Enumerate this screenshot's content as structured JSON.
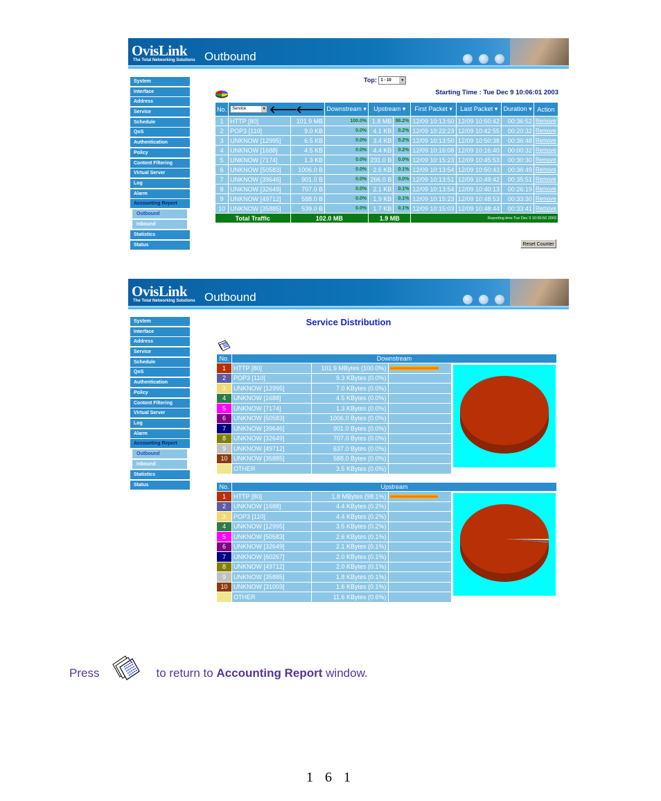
{
  "brand": {
    "logo": "OvisLink",
    "tagline": "The Total Networking Solutions"
  },
  "sidebar": {
    "items": [
      "System",
      "Interface",
      "Address",
      "Service",
      "Schedule",
      "QoS",
      "Authentication",
      "Policy",
      "Content Filtering",
      "Virtual Server",
      "Log",
      "Alarm",
      "Accounting Report"
    ],
    "subitems": [
      "Outbound",
      "Inbound"
    ],
    "after": [
      "Statistics",
      "Status"
    ]
  },
  "screen1": {
    "title": "Outbound",
    "top_label": "Top:",
    "top_value": "1 - 10",
    "starting_time": "Starting Time : Tue Dec 9 10:06:01 2003",
    "service_select": "Service",
    "columns": [
      "No.",
      "Downstream",
      "Upstream",
      "First Packet",
      "Last Packet",
      "Duration",
      "Action"
    ],
    "rows": [
      {
        "no": "1",
        "name": "HTTP [80]",
        "down": "101.9 MB",
        "down_pct": "100.0%",
        "up": "1.8 MB",
        "up_pct": "98.2%",
        "first": "12/09 10:13:50",
        "last": "12/09 10:50:42",
        "dur": "00:36:52",
        "action": "Remove"
      },
      {
        "no": "2",
        "name": "POP3 [110]",
        "down": "9.0 KB",
        "down_pct": "0.0%",
        "up": "4.1 KB",
        "up_pct": "0.2%",
        "first": "12/09 10:22:23",
        "last": "12/09 10:42:55",
        "dur": "00:20:32",
        "action": "Remove"
      },
      {
        "no": "3",
        "name": "UNKNOW [12995]",
        "down": "6.5 KB",
        "down_pct": "0.0%",
        "up": "3.4 KB",
        "up_pct": "0.2%",
        "first": "12/09 10:13:50",
        "last": "12/09 10:50:38",
        "dur": "00:36:48",
        "action": "Remove"
      },
      {
        "no": "4",
        "name": "UNKNOW [1688]",
        "down": "4.5 KB",
        "down_pct": "0.0%",
        "up": "4.4 KB",
        "up_pct": "0.2%",
        "first": "12/09 10:16:08",
        "last": "12/09 10:16:40",
        "dur": "00:00:32",
        "action": "Remove"
      },
      {
        "no": "5",
        "name": "UNKNOW [7174]",
        "down": "1.3 KB",
        "down_pct": "0.0%",
        "up": "231.0 B",
        "up_pct": "0.0%",
        "first": "12/09 10:15:23",
        "last": "12/09 10:45:53",
        "dur": "00:30:30",
        "action": "Remove"
      },
      {
        "no": "6",
        "name": "UNKNOW [50583]",
        "down": "1006.0 B",
        "down_pct": "0.0%",
        "up": "2.6 KB",
        "up_pct": "0.1%",
        "first": "12/09 10:13:54",
        "last": "12/09 10:50:43",
        "dur": "00:36:49",
        "action": "Remove"
      },
      {
        "no": "7",
        "name": "UNKNOW [39646]",
        "down": "901.0 B",
        "down_pct": "0.0%",
        "up": "266.0 B",
        "up_pct": "0.0%",
        "first": "12/09 10:13:51",
        "last": "12/09 10:49:42",
        "dur": "00:35:51",
        "action": "Remove"
      },
      {
        "no": "8",
        "name": "UNKNOW [32649]",
        "down": "707.0 B",
        "down_pct": "0.0%",
        "up": "2.1 KB",
        "up_pct": "0.1%",
        "first": "12/09 10:13:54",
        "last": "12/09 10:40:13",
        "dur": "00:26:19",
        "action": "Remove"
      },
      {
        "no": "9",
        "name": "UNKNOW [49712]",
        "down": "588.0 B",
        "down_pct": "0.0%",
        "up": "1.9 KB",
        "up_pct": "0.1%",
        "first": "12/09 10:15:23",
        "last": "12/09 10:48:53",
        "dur": "00:33:30",
        "action": "Remove"
      },
      {
        "no": "10",
        "name": "UNKNOW [35885]",
        "down": "539.0 B",
        "down_pct": "0.0%",
        "up": "1.7 KB",
        "up_pct": "0.1%",
        "first": "12/09 10:15:03",
        "last": "12/09 10:48:44",
        "dur": "00:33:41",
        "action": "Remove"
      }
    ],
    "total_label": "Total Traffic",
    "total_down": "102.0 MB",
    "total_up": "1.9 MB",
    "reporting_time": "Reporting time Tue Dec 9 10:50:50 2003",
    "reset_button": "Reset Counter"
  },
  "screen2": {
    "title": "Outbound",
    "heading": "Service Distribution",
    "downstream": {
      "no_header": "No.",
      "header": "Downstream",
      "rows": [
        {
          "no": "1",
          "name": "HTTP [80]",
          "value": "101.9 MBytes (100.0%)",
          "color": "#b83005",
          "pct": 100.0
        },
        {
          "no": "2",
          "name": "POP3 [110]",
          "value": "9.3 KBytes (0.0%)",
          "color": "#5a5ea0",
          "pct": 0.0
        },
        {
          "no": "3",
          "name": "UNKNOW [12995]",
          "value": "7.0 KBytes (0.0%)",
          "color": "#f0d878",
          "pct": 0.0
        },
        {
          "no": "4",
          "name": "UNKNOW [1688]",
          "value": "4.5 KBytes (0.0%)",
          "color": "#2f7a4a",
          "pct": 0.0
        },
        {
          "no": "5",
          "name": "UNKNOW [7174]",
          "value": "1.3 KBytes (0.0%)",
          "color": "#ff00ff",
          "pct": 0.0
        },
        {
          "no": "6",
          "name": "UNKNOW [50583]",
          "value": "1006.0 Bytes (0.0%)",
          "color": "#800080",
          "pct": 0.0
        },
        {
          "no": "7",
          "name": "UNKNOW [39646]",
          "value": "901.0 Bytes (0.0%)",
          "color": "#000080",
          "pct": 0.0
        },
        {
          "no": "8",
          "name": "UNKNOW [32649]",
          "value": "707.0 Bytes (0.0%)",
          "color": "#808000",
          "pct": 0.0
        },
        {
          "no": "9",
          "name": "UNKNOW [49712]",
          "value": "637.0 Bytes (0.0%)",
          "color": "#c0c0c0",
          "pct": 0.0
        },
        {
          "no": "10",
          "name": "UNKNOW [35885]",
          "value": "588.0 Bytes (0.0%)",
          "color": "#8b3a0a",
          "pct": 0.0
        },
        {
          "no": "",
          "name": "OTHER",
          "value": "3.5 KBytes (0.0%)",
          "color": "#f0e68c",
          "pct": 0.0
        }
      ]
    },
    "upstream": {
      "no_header": "No.",
      "header": "Upstream",
      "rows": [
        {
          "no": "1",
          "name": "HTTP [80]",
          "value": "1.8 MBytes (98.1%)",
          "color": "#b83005",
          "pct": 98.1
        },
        {
          "no": "2",
          "name": "UNKNOW [1688]",
          "value": "4.4 KBytes (0.2%)",
          "color": "#5a5ea0",
          "pct": 0.2
        },
        {
          "no": "3",
          "name": "POP3 [110]",
          "value": "4.4 KBytes (0.2%)",
          "color": "#f0d878",
          "pct": 0.2
        },
        {
          "no": "4",
          "name": "UNKNOW [12995]",
          "value": "3.5 KBytes (0.2%)",
          "color": "#2f7a4a",
          "pct": 0.2
        },
        {
          "no": "5",
          "name": "UNKNOW [50583]",
          "value": "2.6 KBytes (0.1%)",
          "color": "#ff00ff",
          "pct": 0.1
        },
        {
          "no": "6",
          "name": "UNKNOW [32649]",
          "value": "2.1 KBytes (0.1%)",
          "color": "#800080",
          "pct": 0.1
        },
        {
          "no": "7",
          "name": "UNKNOW [60267]",
          "value": "2.0 KBytes (0.1%)",
          "color": "#000080",
          "pct": 0.1
        },
        {
          "no": "8",
          "name": "UNKNOW [49712]",
          "value": "2.0 KBytes (0.1%)",
          "color": "#808000",
          "pct": 0.1
        },
        {
          "no": "9",
          "name": "UNKNOW [35885]",
          "value": "1.8 KBytes (0.1%)",
          "color": "#c0c0c0",
          "pct": 0.1
        },
        {
          "no": "10",
          "name": "UNKNOW [31003]",
          "value": "1.6 KBytes (0.1%)",
          "color": "#8b3a0a",
          "pct": 0.1
        },
        {
          "no": "",
          "name": "OTHER",
          "value": "11.6 KBytes (0.6%)",
          "color": "#f0e68c",
          "pct": 0.6
        }
      ]
    }
  },
  "caption": {
    "press": "Press",
    "middle": "to return to",
    "bold": "Accounting Report",
    "end": "window."
  },
  "page_number": "161"
}
